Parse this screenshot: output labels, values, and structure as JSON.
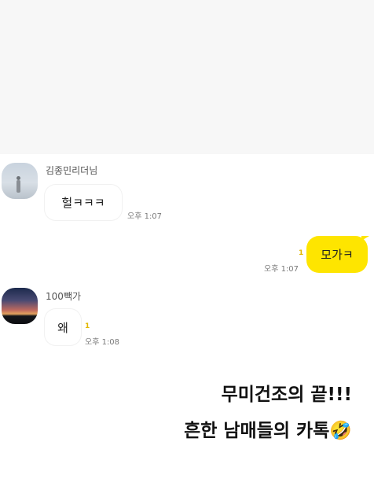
{
  "messages": [
    {
      "sender": "김종민리더님",
      "text": "헐ㅋㅋㅋ",
      "time": "오후 1:07",
      "unread": ""
    },
    {
      "sender": "",
      "text": "모가ㅋ",
      "time": "오후 1:07",
      "unread": "1"
    },
    {
      "sender": "100빽가",
      "text": "왜",
      "time": "오후 1:08",
      "unread": "1"
    }
  ],
  "caption": {
    "line1": "무미건조의 끝!!!",
    "line2": "흔한 남매들의 카톡",
    "emoji": "🤣"
  },
  "colors": {
    "outgoing_bubble": "#fee500",
    "incoming_bubble": "#ffffff",
    "top_area": "#f7f7f7"
  }
}
